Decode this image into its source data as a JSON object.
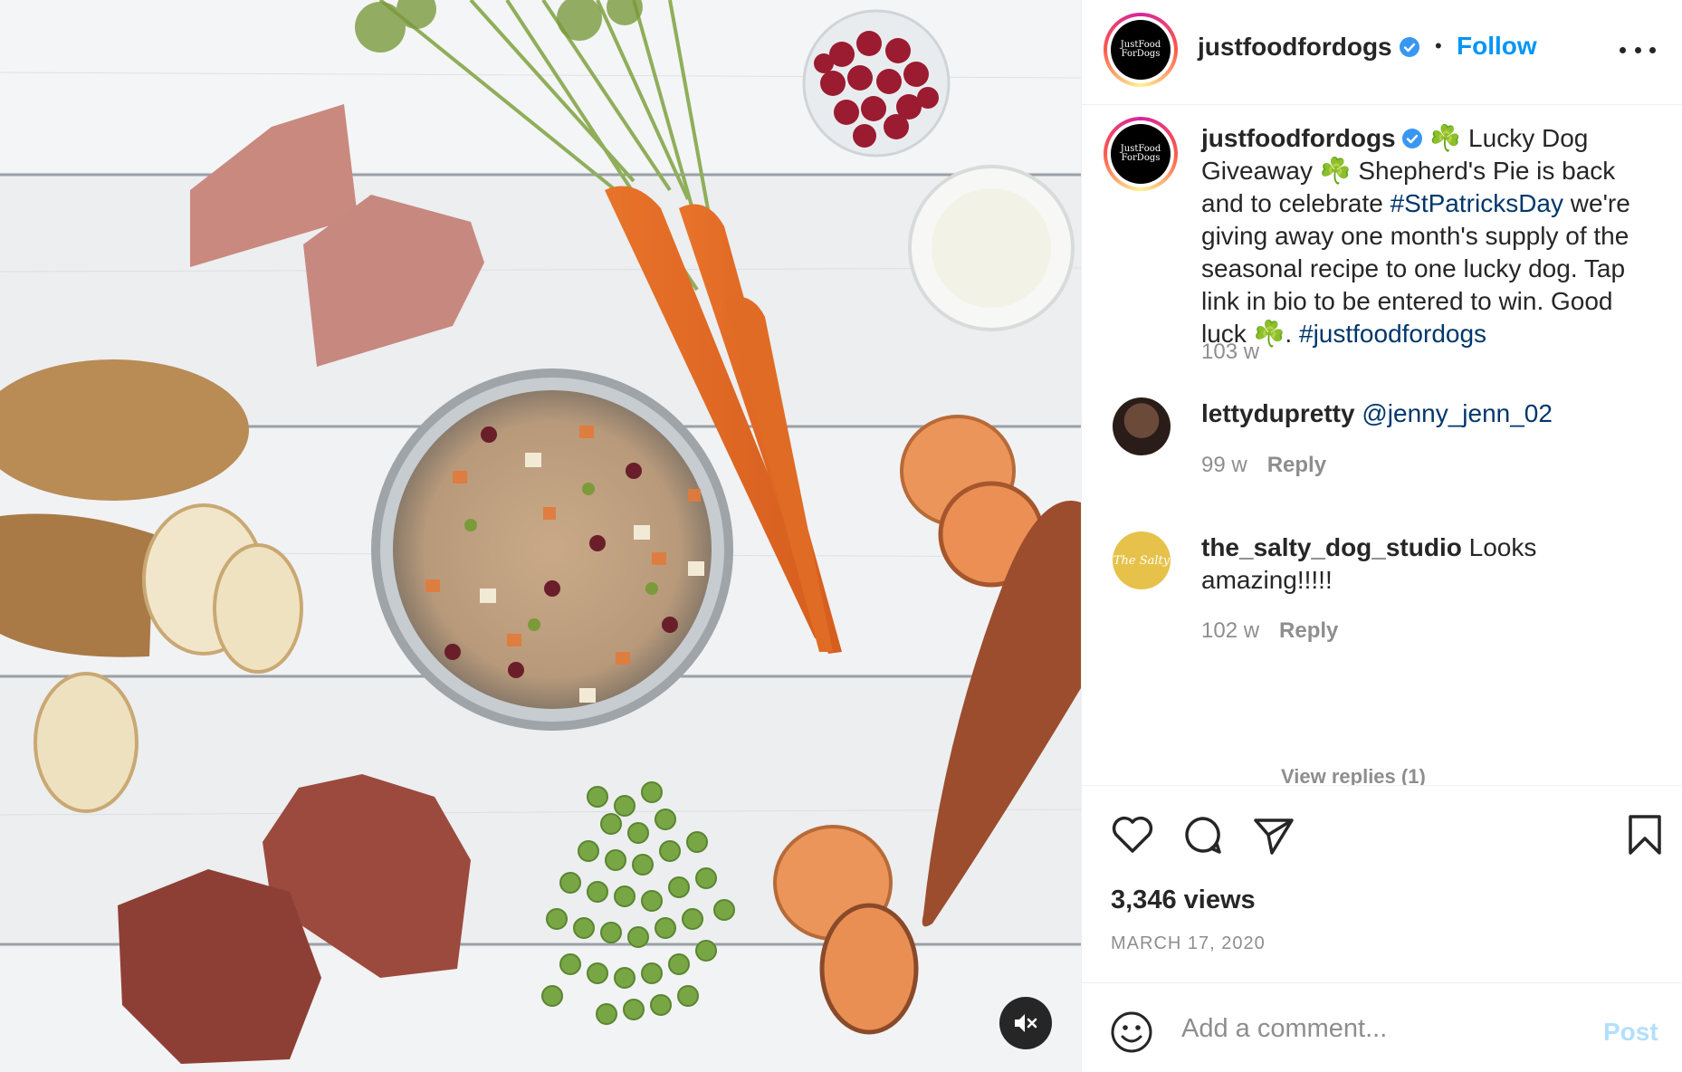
{
  "post": {
    "author": "justfoodfordogs",
    "follow_label": "Follow",
    "separator": "•",
    "avatar_text_line1": "JustFood",
    "avatar_text_line2": "ForDogs",
    "media": {
      "muted": true
    }
  },
  "caption": {
    "username": "justfoodfordogs",
    "part1": " ☘️ Lucky Dog Giveaway ☘️ Shepherd's Pie is back and to celebrate ",
    "hashtag1": "#StPatricksDay",
    "part2": " we're giving away one month's supply of the seasonal recipe to one lucky dog. Tap link in bio to be entered to win. Good luck ☘️. ",
    "hashtag2": "#justfoodfordogs",
    "age": "103 w"
  },
  "comments": [
    {
      "username": "lettydupretty",
      "mention": "@jenny_jenn_02",
      "text": "",
      "age": "99 w",
      "reply_label": "Reply"
    },
    {
      "username": "the_salty_dog_studio",
      "mention": "",
      "text": " Looks amazing!!!!!",
      "age": "102 w",
      "reply_label": "Reply",
      "avatar_text": "The Salty"
    }
  ],
  "view_replies": "View replies (1)",
  "stats": {
    "views": "3,346 views",
    "date": "MARCH 17, 2020"
  },
  "add_comment": {
    "placeholder": "Add a comment...",
    "post_label": "Post"
  },
  "colors": {
    "link": "#0095f6",
    "hashtag": "#00376b",
    "muted_text": "#8e8e8e",
    "post_disabled": "#b2dffc"
  }
}
